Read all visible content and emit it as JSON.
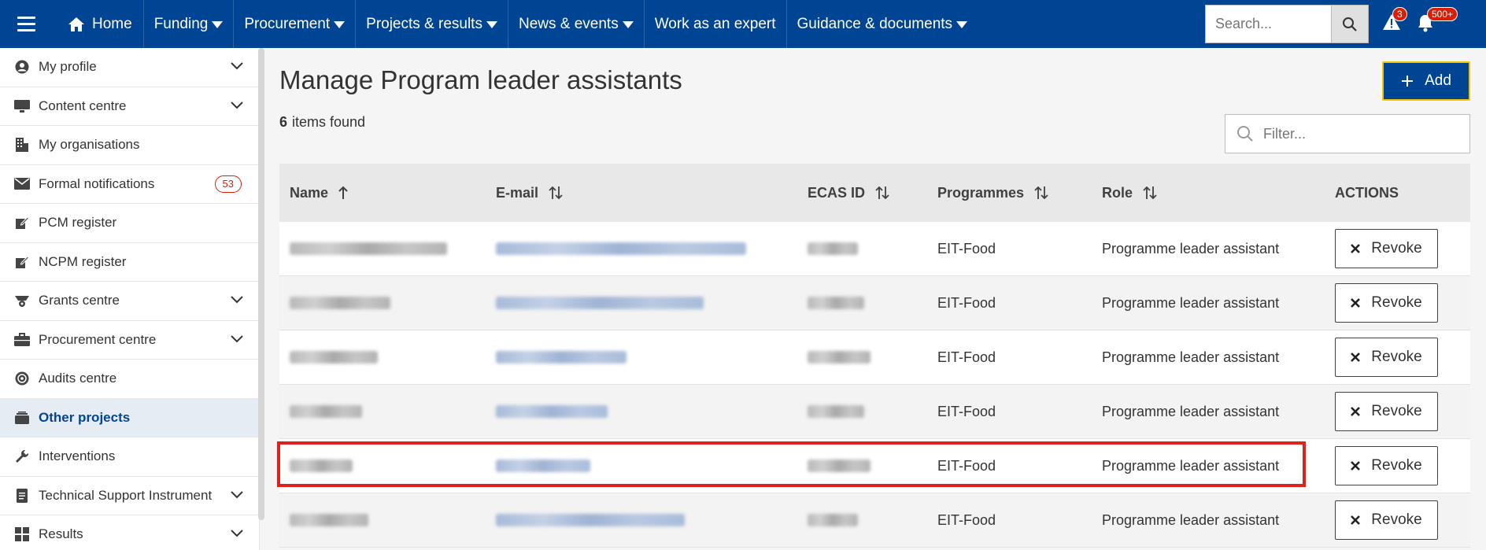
{
  "topbar": {
    "home_label": "Home",
    "nav": [
      "Funding",
      "Procurement",
      "Projects & results",
      "News & events"
    ],
    "expert_label": "Work as an expert",
    "guidance_label": "Guidance & documents",
    "search_placeholder": "Search...",
    "alert_count": "3",
    "notification_count": "500+",
    "bg_color": "#004494"
  },
  "sidebar": {
    "items": [
      {
        "label": "My profile",
        "icon": "user-circle-icon",
        "expandable": true
      },
      {
        "label": "Content centre",
        "icon": "monitor-icon",
        "expandable": true
      },
      {
        "label": "My organisations",
        "icon": "building-icon",
        "expandable": false
      },
      {
        "label": "Formal notifications",
        "icon": "envelope-icon",
        "badge": "53"
      },
      {
        "label": "PCM register",
        "icon": "edit-icon",
        "expandable": false
      },
      {
        "label": "NCPM register",
        "icon": "edit-icon",
        "expandable": false
      },
      {
        "label": "Grants centre",
        "icon": "grants-icon",
        "expandable": true
      },
      {
        "label": "Procurement centre",
        "icon": "briefcase-icon",
        "expandable": true
      },
      {
        "label": "Audits centre",
        "icon": "target-icon",
        "expandable": false
      },
      {
        "label": "Other projects",
        "icon": "stack-icon",
        "active": true
      },
      {
        "label": "Interventions",
        "icon": "wrench-icon",
        "expandable": false
      },
      {
        "label": "Technical Support Instrument",
        "icon": "document-icon",
        "expandable": true
      },
      {
        "label": "Results",
        "icon": "grid-icon",
        "expandable": true
      }
    ]
  },
  "main": {
    "title": "Manage Program leader assistants",
    "count": "6",
    "count_suffix": "items found",
    "add_label": "Add",
    "filter_placeholder": "Filter...",
    "columns": {
      "name": "Name",
      "email": "E-mail",
      "ecas": "ECAS ID",
      "programmes": "Programmes",
      "role": "Role",
      "actions": "ACTIONS"
    },
    "revoke_label": "Revoke",
    "rows": [
      {
        "programme": "EIT-Food",
        "role": "Programme leader assistant"
      },
      {
        "programme": "EIT-Food",
        "role": "Programme leader assistant"
      },
      {
        "programme": "EIT-Food",
        "role": "Programme leader assistant"
      },
      {
        "programme": "EIT-Food",
        "role": "Programme leader assistant"
      },
      {
        "programme": "EIT-Food",
        "role": "Programme leader assistant",
        "highlighted": true
      },
      {
        "programme": "EIT-Food",
        "role": "Programme leader assistant"
      }
    ]
  }
}
